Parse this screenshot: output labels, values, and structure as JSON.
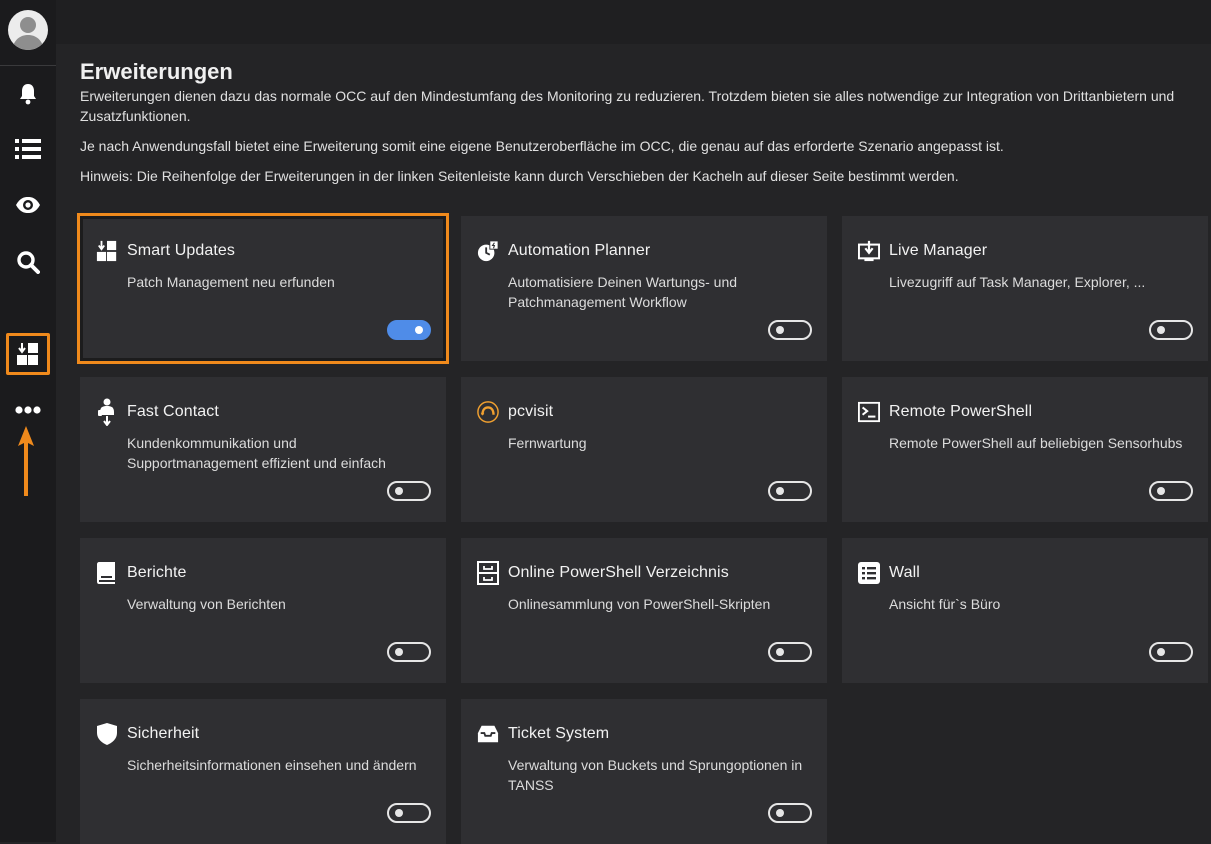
{
  "sidebar": {
    "items": [
      {
        "name": "bell-icon"
      },
      {
        "name": "list-icon"
      },
      {
        "name": "eye-icon"
      },
      {
        "name": "search-icon"
      },
      {
        "name": "smart-updates-icon",
        "active": true
      },
      {
        "name": "more-icon"
      }
    ]
  },
  "page": {
    "title": "Erweiterungen",
    "desc1": "Erweiterungen dienen dazu das normale OCC auf den Mindestumfang des Monitoring zu reduzieren. Trotzdem bieten sie alles notwendige zur Integration von Drittanbietern und Zusatzfunktionen.",
    "desc2": "Je nach Anwendungsfall bietet eine Erweiterung somit eine eigene Benutzeroberfläche im OCC, die genau auf das erforderte Szenario angepasst ist.",
    "desc3": "Hinweis: Die Reihenfolge der Erweiterungen in der linken Seitenleiste kann durch Verschieben der Kacheln auf dieser Seite bestimmt werden."
  },
  "tiles": [
    {
      "title": "Smart Updates",
      "desc": "Patch Management neu erfunden",
      "icon": "smart-updates-icon",
      "enabled": true
    },
    {
      "title": "Automation Planner",
      "desc": "Automatisiere Deinen Wartungs- und Patchmanagement Workflow",
      "icon": "automation-planner-icon",
      "enabled": false
    },
    {
      "title": "Live Manager",
      "desc": "Livezugriff auf Task Manager, Explorer, ...",
      "icon": "live-manager-icon",
      "enabled": false
    },
    {
      "title": "Fast Contact",
      "desc": "Kundenkommunikation und Supportmanagement effizient und einfach",
      "icon": "fast-contact-icon",
      "enabled": false
    },
    {
      "title": "pcvisit",
      "desc": "Fernwartung",
      "icon": "pcvisit-icon",
      "enabled": false
    },
    {
      "title": "Remote PowerShell",
      "desc": "Remote PowerShell auf beliebigen Sensorhubs",
      "icon": "terminal-icon",
      "enabled": false
    },
    {
      "title": "Berichte",
      "desc": "Verwaltung von Berichten",
      "icon": "report-book-icon",
      "enabled": false
    },
    {
      "title": "Online PowerShell Verzeichnis",
      "desc": "Onlinesammlung von PowerShell-Skripten",
      "icon": "file-cabinet-icon",
      "enabled": false
    },
    {
      "title": "Wall",
      "desc": "Ansicht für`s Büro",
      "icon": "list-box-icon",
      "enabled": false
    },
    {
      "title": "Sicherheit",
      "desc": "Sicherheitsinformationen einsehen und ändern",
      "icon": "shield-icon",
      "enabled": false
    },
    {
      "title": "Ticket System",
      "desc": "Verwaltung von Buckets und Sprungoptionen in TANSS",
      "icon": "inbox-tray-icon",
      "enabled": false
    }
  ],
  "colors": {
    "accent": "#f08a1c",
    "toggle_on": "#4f8ce8",
    "pcvisit": "#f0a030"
  }
}
